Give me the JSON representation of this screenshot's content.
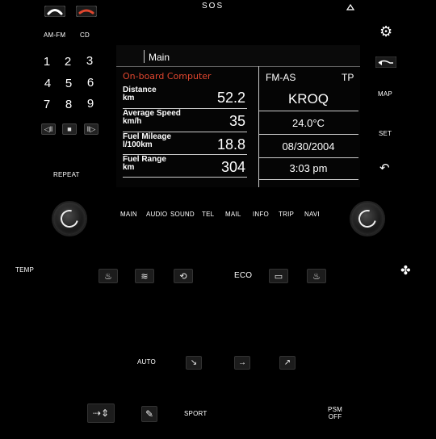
{
  "top": {
    "sos": "SOS",
    "eject_icon": "eject-icon"
  },
  "left": {
    "am_fm": "AM-FM",
    "cd": "CD",
    "keys": [
      "1",
      "2",
      "3",
      "4",
      "5",
      "6",
      "7",
      "8",
      "9"
    ],
    "repeat": "REPEAT"
  },
  "right": {
    "map": "MAP",
    "set": "SET"
  },
  "screen": {
    "tab": "Main",
    "section": "On-board Computer",
    "rows": [
      {
        "title": "Distance",
        "unit": "km",
        "value": "52.2"
      },
      {
        "title": "Average Speed",
        "unit": "km/h",
        "value": "35"
      },
      {
        "title": "Fuel Mileage",
        "unit": "l/100km",
        "value": "18.8"
      },
      {
        "title": "Fuel Range",
        "unit": "km",
        "value": "304"
      }
    ],
    "radio": {
      "band": "FM-AS",
      "tp": "TP",
      "station": "KROQ"
    },
    "temp": "24.0°C",
    "date": "08/30/2004",
    "time": "3:03 pm"
  },
  "nav": [
    "MAIN",
    "AUDIO",
    "SOUND",
    "TEL",
    "MAIL",
    "INFO",
    "TRIP",
    "NAVI"
  ],
  "climate": {
    "temp": "TEMP",
    "eco": "ECO",
    "auto": "AUTO"
  },
  "bottom": {
    "sport": "SPORT",
    "psm_1": "PSM",
    "psm_2": "OFF"
  },
  "colors": {
    "accent_red": "#e0462e",
    "phone_green": "#e8e8e8",
    "background": "#000000"
  }
}
